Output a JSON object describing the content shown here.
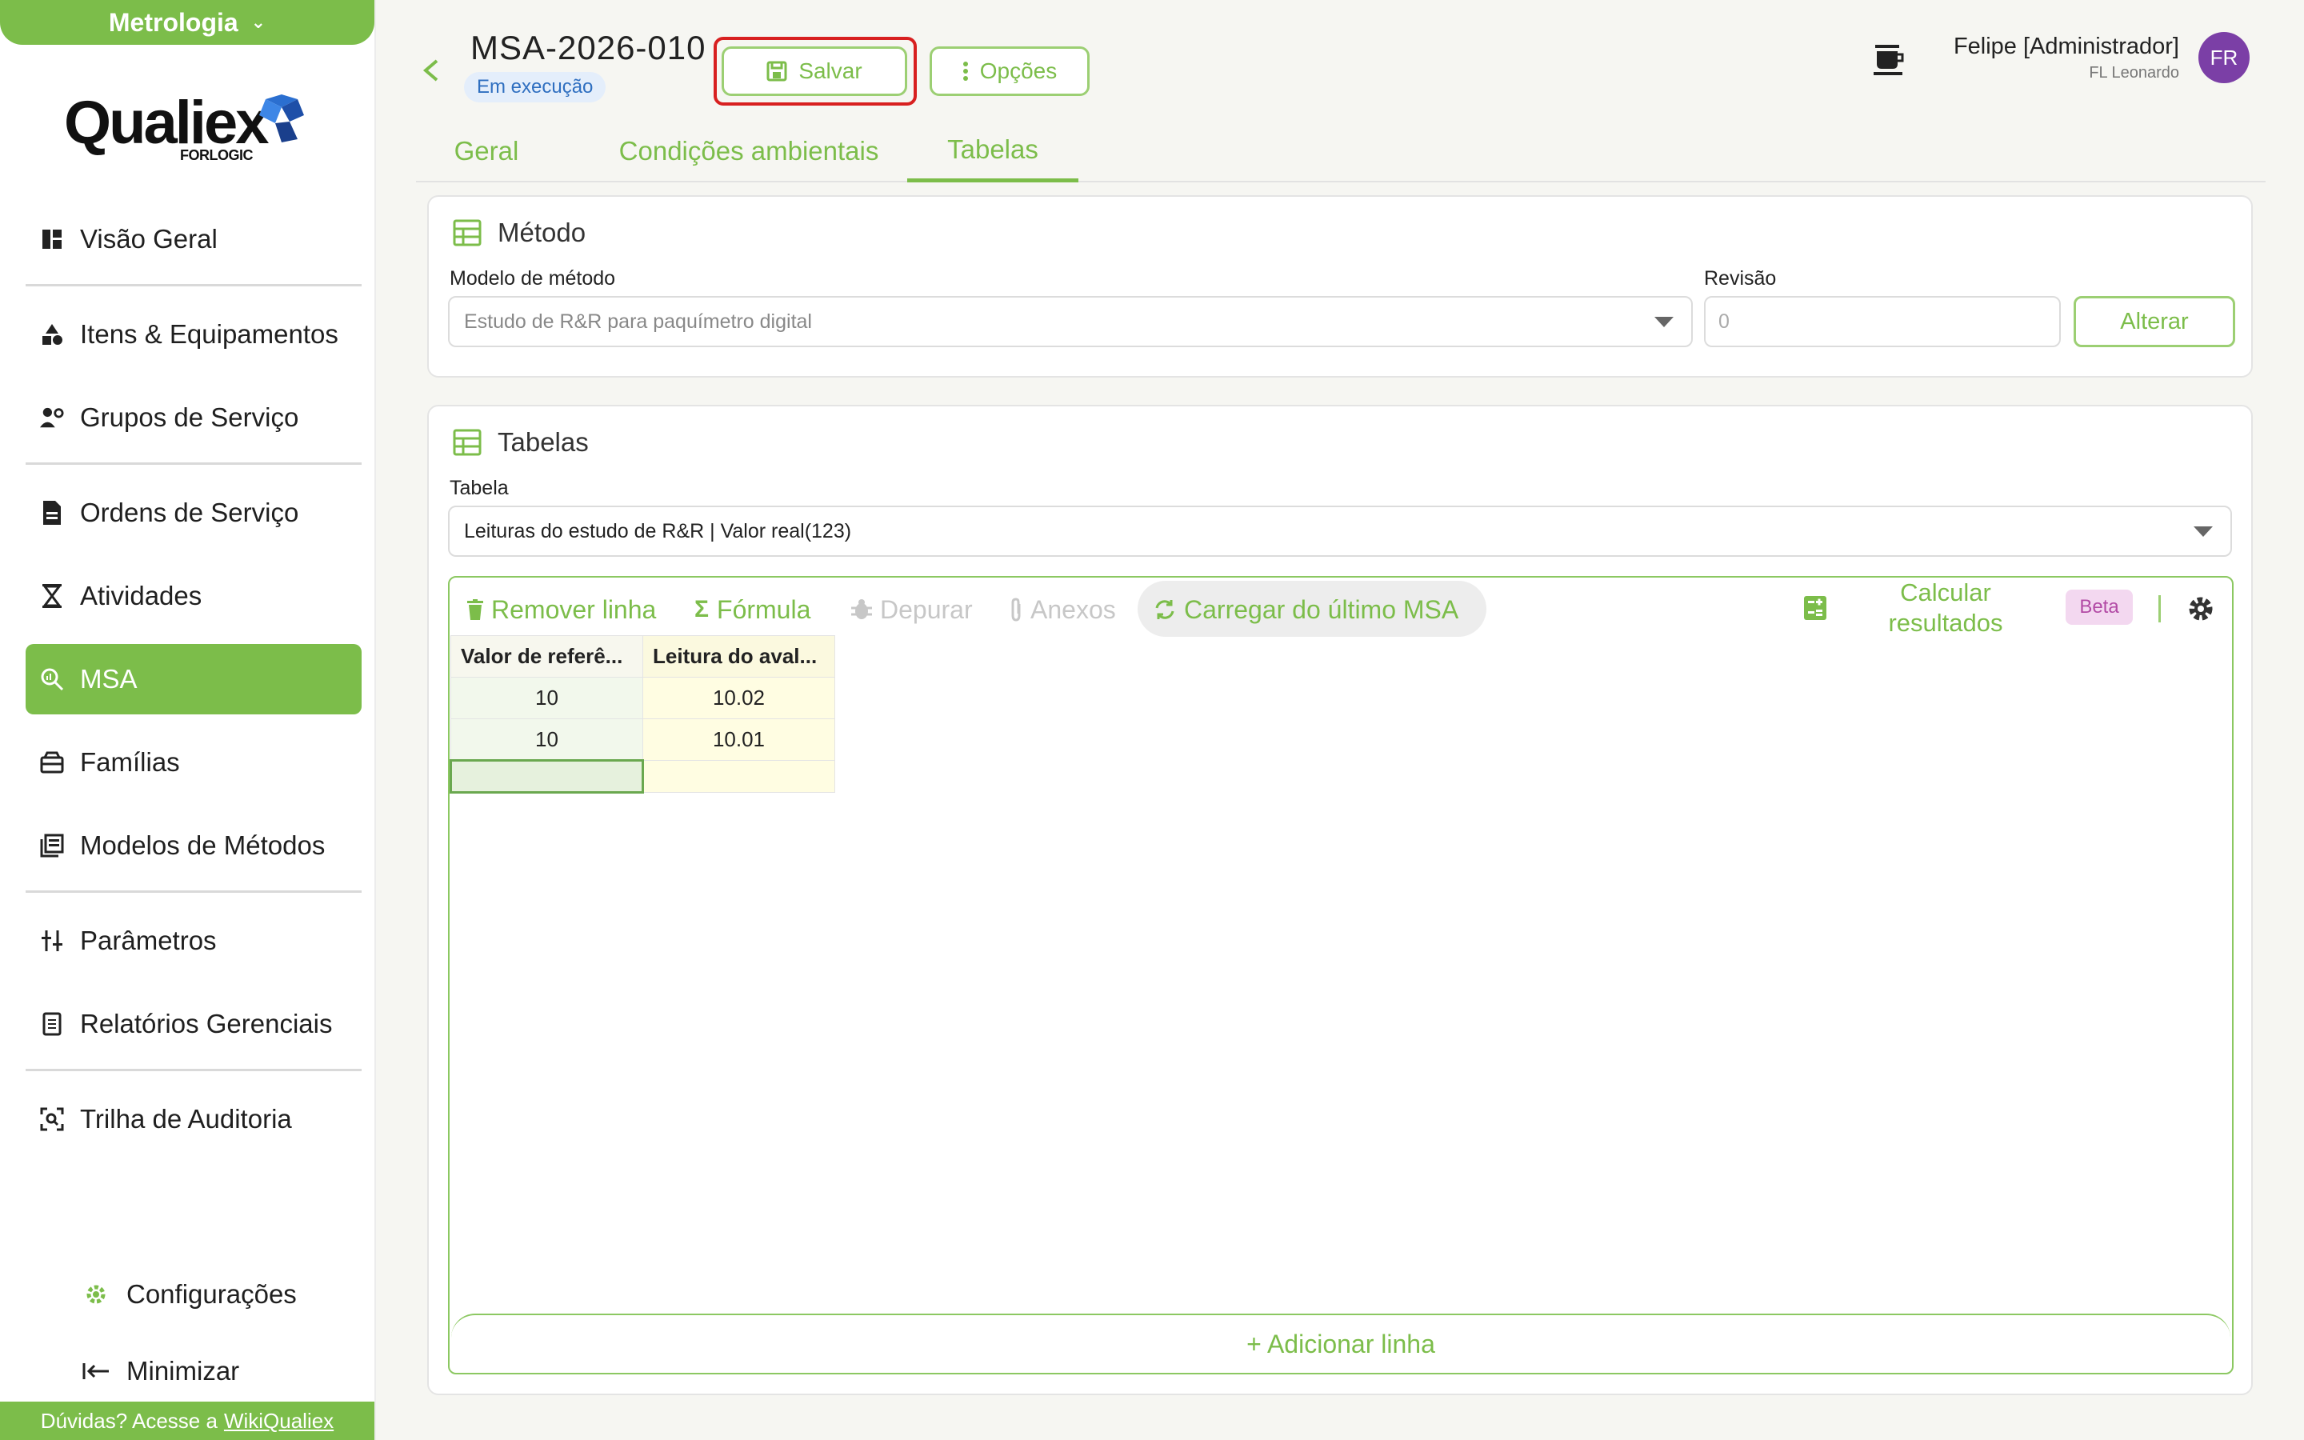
{
  "sidebar": {
    "module_label": "Metrologia",
    "logo_text": "Qualiex",
    "logo_sub": "FORLOGIC",
    "items": [
      {
        "label": "Visão Geral"
      },
      {
        "label": "Itens & Equipamentos"
      },
      {
        "label": "Grupos de Serviço"
      },
      {
        "label": "Ordens de Serviço"
      },
      {
        "label": "Atividades"
      },
      {
        "label": "MSA"
      },
      {
        "label": "Famílias"
      },
      {
        "label": "Modelos de Métodos"
      },
      {
        "label": "Parâmetros"
      },
      {
        "label": "Relatórios Gerenciais"
      },
      {
        "label": "Trilha de Auditoria"
      }
    ],
    "active_item": "MSA",
    "settings_label": "Configurações",
    "minimize_label": "Minimizar",
    "help_text": "Dúvidas? Acesse a",
    "help_link": "WikiQualiex"
  },
  "header": {
    "title": "MSA-2026-010",
    "status": "Em execução",
    "save_label": "Salvar",
    "options_label": "Opções",
    "user_name": "Felipe [Administrador]",
    "user_company": "FL Leonardo",
    "avatar_initials": "FR"
  },
  "tabs": [
    {
      "label": "Geral"
    },
    {
      "label": "Condições ambientais"
    },
    {
      "label": "Tabelas"
    }
  ],
  "active_tab": "Tabelas",
  "method": {
    "title": "Método",
    "model_label": "Modelo de método",
    "model_value": "Estudo de R&R para paquímetro digital",
    "revision_label": "Revisão",
    "revision_placeholder": "0",
    "change_label": "Alterar"
  },
  "tables": {
    "title": "Tabelas",
    "table_label": "Tabela",
    "table_value": "Leituras do estudo de R&R | Valor real(123)",
    "toolbar": {
      "remove_row": "Remover linha",
      "formula": "Fórmula",
      "debug": "Depurar",
      "attachments": "Anexos",
      "load_last": "Carregar do último MSA",
      "calc_results": "Calcular resultados",
      "beta": "Beta"
    },
    "columns": [
      "Valor de referê...",
      "Leitura do aval..."
    ],
    "rows": [
      [
        "10",
        "10.02"
      ],
      [
        "10",
        "10.01"
      ],
      [
        "",
        ""
      ]
    ],
    "add_row": "+ Adicionar linha"
  },
  "colors": {
    "accent": "#7cbd4a",
    "avatar": "#7b3fa6",
    "highlight": "#d82020",
    "status_bg": "#e4eefb",
    "status_text": "#2f6fc0",
    "beta_bg": "#f3d8f0"
  }
}
